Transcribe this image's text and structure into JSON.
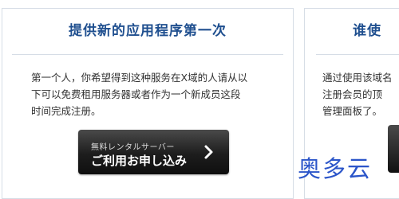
{
  "left_card": {
    "title": "提供新的应用程序第一次",
    "body_lines": [
      "第一个人，你希望得到这种服务在X域的人请从以",
      "下可以免费租用服务器或者作为一个新成员这段",
      "时间完成注册。"
    ],
    "button": {
      "small_label": "無料レンタルサーバー",
      "main_label": "ご利用お申し込み",
      "icon": "chevron-right-icon"
    }
  },
  "right_card": {
    "title": "谁使",
    "body_lines": [
      "通过使用该域名",
      "注册会员的顶",
      "管理面板了。"
    ]
  },
  "watermark": {
    "text": "奥多云",
    "color": "#2b55c9"
  },
  "colors": {
    "title": "#1f4f8f",
    "border": "#d6dde6",
    "button_dark": "#1d1d1d"
  }
}
